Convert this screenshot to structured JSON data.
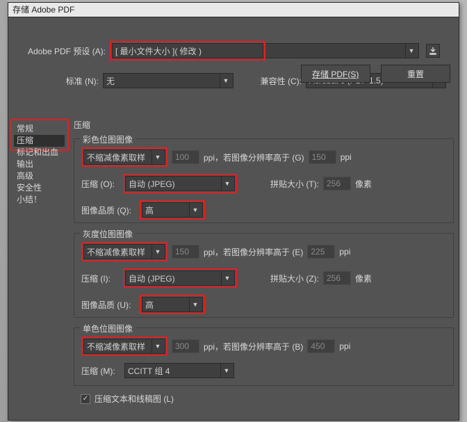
{
  "window": {
    "title": "存储 Adobe PDF"
  },
  "top": {
    "presetLabel": "Adobe PDF 预设 (A):",
    "presetValue": "[ 最小文件大小 ]( 修改 )",
    "saveIcon": "save-preset-icon",
    "standardLabel": "标准 (N):",
    "standardValue": "无",
    "compatLabel": "兼容性 (C):",
    "compatValue": "Acrobat 6 (PDF 1.5)"
  },
  "sidebar": {
    "items": [
      "常规",
      "压缩",
      "标记和出血",
      "输出",
      "高级",
      "安全性",
      "小结！"
    ],
    "activeIndex": 1
  },
  "sectionTitle": "压缩",
  "color": {
    "legend": "彩色位图图像",
    "downsample": "不缩减像素取样",
    "ppi": "100",
    "ppiUnit": "ppi，若图像分辨率高于 (G)",
    "above": "150",
    "aboveUnit": "ppi",
    "compLabel": "压缩 (O):",
    "compValue": "自动 (JPEG)",
    "tileLabel": "拼贴大小 (T):",
    "tileValue": "256",
    "tileUnit": "像素",
    "qualityLabel": "图像品质 (Q):",
    "qualityValue": "高"
  },
  "gray": {
    "legend": "灰度位图图像",
    "downsample": "不缩减像素取样",
    "ppi": "150",
    "ppiUnit": "ppi，若图像分辨率高于 (E)",
    "above": "225",
    "aboveUnit": "ppi",
    "compLabel": "压缩 (I):",
    "compValue": "自动 (JPEG)",
    "tileLabel": "拼贴大小 (Z):",
    "tileValue": "256",
    "tileUnit": "像素",
    "qualityLabel": "图像品质 (U):",
    "qualityValue": "高"
  },
  "mono": {
    "legend": "单色位图图像",
    "downsample": "不缩减像素取样",
    "ppi": "300",
    "ppiUnit": "ppi，若图像分辨率高于 (B)",
    "above": "450",
    "aboveUnit": "ppi",
    "compLabel": "压缩 (M):",
    "compValue": "CCITT 组 4"
  },
  "compressText": {
    "label": "压缩文本和线稿图 (L)",
    "checked": true
  },
  "buttons": {
    "save": "存储 PDF(S)",
    "reset": "重置"
  },
  "highlightColor": "#e02020"
}
